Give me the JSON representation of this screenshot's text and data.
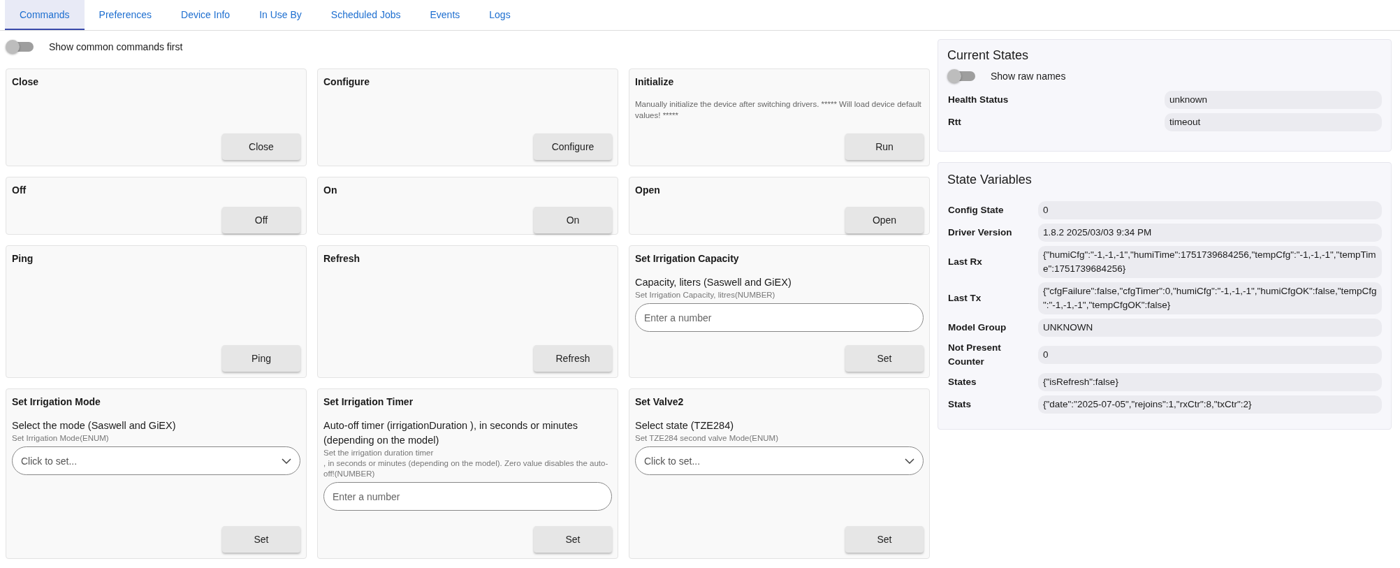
{
  "tabs": [
    {
      "label": "Commands",
      "selected": true
    },
    {
      "label": "Preferences",
      "selected": false
    },
    {
      "label": "Device Info",
      "selected": false
    },
    {
      "label": "In Use By",
      "selected": false
    },
    {
      "label": "Scheduled Jobs",
      "selected": false
    },
    {
      "label": "Events",
      "selected": false
    },
    {
      "label": "Logs",
      "selected": false
    }
  ],
  "common_toggle": {
    "label": "Show common commands first",
    "on": false
  },
  "commands": [
    {
      "kind": "button",
      "title": "Close",
      "button": "Close"
    },
    {
      "kind": "button",
      "title": "Configure",
      "button": "Configure"
    },
    {
      "kind": "button",
      "title": "Initialize",
      "description": "Manually initialize the device after switching drivers. ***** Will load device default values! *****",
      "button": "Run"
    },
    {
      "kind": "button",
      "title": "Off",
      "button": "Off"
    },
    {
      "kind": "button",
      "title": "On",
      "button": "On"
    },
    {
      "kind": "button",
      "title": "Open",
      "button": "Open"
    },
    {
      "kind": "button",
      "title": "Ping",
      "button": "Ping"
    },
    {
      "kind": "button",
      "title": "Refresh",
      "button": "Refresh"
    },
    {
      "kind": "number",
      "title": "Set Irrigation Capacity",
      "param_label": "Capacity, liters (Saswell and GiEX)",
      "param_hint": "Set Irrigation Capacity, litres(NUMBER)",
      "placeholder": "Enter a number",
      "button": "Set"
    },
    {
      "kind": "select",
      "title": "Set Irrigation Mode",
      "param_label": "Select the mode (Saswell and GiEX)",
      "param_hint": "Set Irrigation Mode(ENUM)",
      "placeholder": "Click to set...",
      "button": "Set"
    },
    {
      "kind": "number",
      "title": "Set Irrigation Timer",
      "param_label": "Auto-off timer (irrigationDuration ), in seconds or minutes (depending on the model)",
      "param_hint": "Set the irrigation duration timer\n, in seconds or minutes (depending on the model). Zero value disables the auto-off!(NUMBER)",
      "placeholder": "Enter a number",
      "button": "Set"
    },
    {
      "kind": "select",
      "title": "Set Valve2",
      "param_label": "Select state (TZE284)",
      "param_hint": "Set TZE284 second valve Mode(ENUM)",
      "placeholder": "Click to set...",
      "button": "Set"
    }
  ],
  "current_states": {
    "title": "Current States",
    "toggle": {
      "label": "Show raw names",
      "on": false
    },
    "rows": [
      {
        "name": "Health Status",
        "value": "unknown"
      },
      {
        "name": "Rtt",
        "value": "timeout"
      }
    ]
  },
  "state_variables": {
    "title": "State Variables",
    "rows": [
      {
        "name": "Config State",
        "value": "0"
      },
      {
        "name": "Driver Version",
        "value": "1.8.2 2025/03/03 9:34 PM"
      },
      {
        "name": "Last Rx",
        "value": "{\"humiCfg\":\"-1,-1,-1\",\"humiTime\":1751739684256,\"tempCfg\":\"-1,-1,-1\",\"tempTime\":1751739684256}"
      },
      {
        "name": "Last Tx",
        "value": "{\"cfgFailure\":false,\"cfgTimer\":0,\"humiCfg\":\"-1,-1,-1\",\"humiCfgOK\":false,\"tempCfg\":\"-1,-1,-1\",\"tempCfgOK\":false}"
      },
      {
        "name": "Model Group",
        "value": "UNKNOWN"
      },
      {
        "name": "Not Present Counter",
        "value": "0"
      },
      {
        "name": "States",
        "value": "{\"isRefresh\":false}"
      },
      {
        "name": "Stats",
        "value": "{\"date\":\"2025-07-05\",\"rejoins\":1,\"rxCtr\":8,\"txCtr\":2}"
      }
    ]
  }
}
